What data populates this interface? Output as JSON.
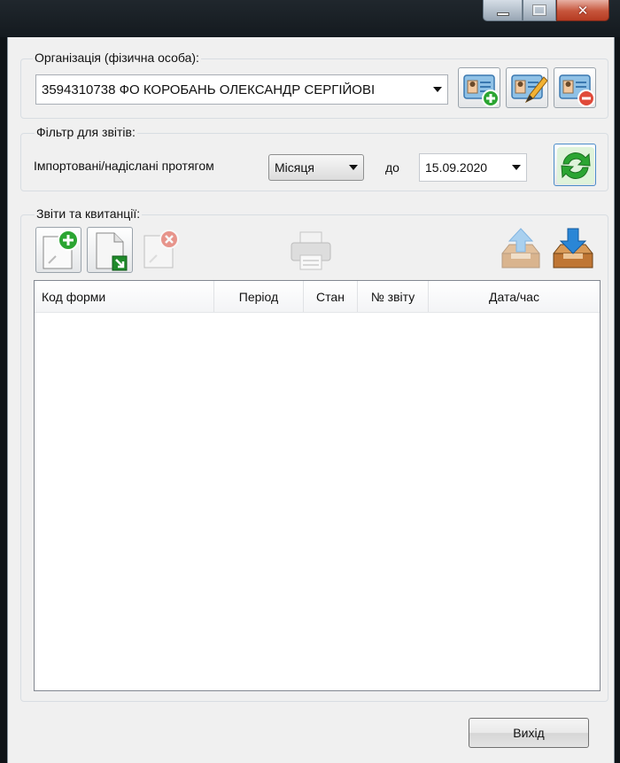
{
  "window": {
    "minimize_icon": "minimize-icon",
    "maximize_icon": "maximize-icon",
    "close_glyph": "✕"
  },
  "organization": {
    "label": "Організація (фізична особа):",
    "selected": "3594310738 ФО КОРОБАНЬ ОЛЕКСАНДР СЕРГІЙОВІ",
    "icons": [
      "add-card-icon",
      "edit-card-icon",
      "delete-card-icon"
    ]
  },
  "filter": {
    "label": "Фільтр для звітів:",
    "period_text": "Імпортовані/надіслані протягом",
    "period_value": "Місяця",
    "to_label": "до",
    "date_value": "15.09.2020",
    "refresh_icon": "refresh-icon"
  },
  "reports": {
    "label": "Звіти та квитанції:",
    "columns": [
      "Код форми",
      "Період",
      "Стан",
      "№ звіту",
      "Дата/час"
    ],
    "rows": [],
    "toolbar_icons": [
      "new-document-icon",
      "import-document-icon",
      "delete-document-icon",
      "print-icon",
      "upload-tray-icon",
      "download-tray-icon"
    ]
  },
  "footer": {
    "exit_label": "Вихід"
  },
  "colors": {
    "window_bg": "#f0f0f0",
    "accent_green": "#2ba532",
    "accent_red": "#e04a3a",
    "accent_blue": "#2a86d6"
  }
}
